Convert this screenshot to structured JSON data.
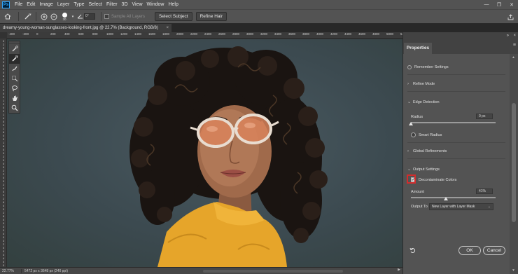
{
  "menubar": {
    "logo": "Ps",
    "items": [
      "File",
      "Edit",
      "Image",
      "Layer",
      "Type",
      "Select",
      "Filter",
      "3D",
      "View",
      "Window",
      "Help"
    ]
  },
  "optionsbar": {
    "brush_size": "30",
    "angle": "0°",
    "sample_all_layers": "Sample All Layers",
    "select_subject": "Select Subject",
    "refine_hair": "Refine Hair"
  },
  "document": {
    "tab_title": "dreamy-young-woman-sunglasses-looking-front.jpg @ 22.7% (Background, RGB/8)",
    "close": "×"
  },
  "rulers": {
    "horizontal": [
      "-400",
      "-200",
      "0",
      "200",
      "400",
      "600",
      "800",
      "1000",
      "1200",
      "1400",
      "1600",
      "1800",
      "2000",
      "2200",
      "2400",
      "2600",
      "2800",
      "3000",
      "3200",
      "3400",
      "3600",
      "3800",
      "4000",
      "4200",
      "4400",
      "4600",
      "4800",
      "5000",
      "5200"
    ],
    "vertical": [
      "0",
      "2",
      "0",
      "0",
      "4",
      "0",
      "0",
      "6",
      "0",
      "0",
      "8",
      "0",
      "0",
      "1",
      "0",
      "0",
      "0",
      "1",
      "2",
      "0",
      "0",
      "1",
      "4",
      "0",
      "0",
      "1",
      "6",
      "0",
      "0",
      "1",
      "8",
      "0",
      "0",
      "2",
      "0",
      "0",
      "0",
      "2",
      "2",
      "0",
      "0",
      "2",
      "4",
      "0",
      "0",
      "2",
      "6",
      "0",
      "0",
      "2",
      "8",
      "0",
      "0",
      "3",
      "0",
      "0",
      "0",
      "3",
      "2",
      "0",
      "0",
      "3",
      "4",
      "0",
      "0"
    ]
  },
  "status": {
    "zoom": "22.77%",
    "doc_info": "5472 px x 3648 px (240 ppi)"
  },
  "properties": {
    "tab": "Properties",
    "remember_settings": "Remember Settings",
    "refine_mode": "Refine Mode",
    "edge_detection": "Edge Detection",
    "radius_label": "Radius",
    "radius_value": "0 px",
    "radius_level": 0,
    "smart_radius": "Smart Radius",
    "global_refinements": "Global Refinements",
    "output_settings": "Output Settings",
    "decontaminate": "Decontaminate Colors",
    "decontaminate_check": "✓",
    "amount_label": "Amount",
    "amount_value": "41%",
    "amount_level": 0.41,
    "output_to_label": "Output To",
    "output_to_value": "New Layer with Layer Mask",
    "ok": "OK",
    "cancel": "Cancel"
  }
}
